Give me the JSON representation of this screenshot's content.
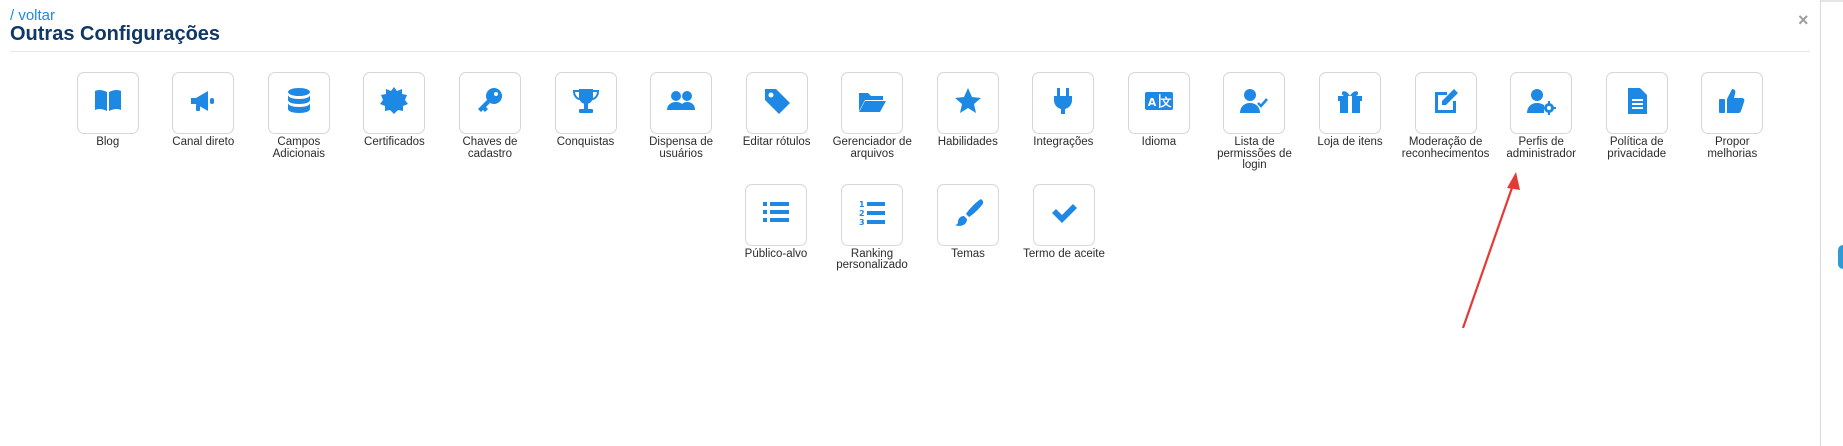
{
  "header": {
    "back_label": "/ voltar",
    "title": "Outras Configurações",
    "close_label": "×"
  },
  "colors": {
    "accent": "#1e88e5",
    "title": "#0f3866",
    "annotation_arrow": "#e53935"
  },
  "items_row1": [
    {
      "label": "Blog",
      "icon": "book-icon"
    },
    {
      "label": "Canal direto",
      "icon": "megaphone-icon"
    },
    {
      "label": "Campos\nAdicionais",
      "icon": "database-icon"
    },
    {
      "label": "Certificados",
      "icon": "certificate-icon"
    },
    {
      "label": "Chaves de\ncadastro",
      "icon": "key-icon"
    },
    {
      "label": "Conquistas",
      "icon": "trophy-icon"
    },
    {
      "label": "Dispensa de\nusuários",
      "icon": "users-icon"
    },
    {
      "label": "Editar rótulos",
      "icon": "tag-icon"
    },
    {
      "label": "Gerenciador de\narquivos",
      "icon": "folder-open-icon"
    },
    {
      "label": "Habilidades",
      "icon": "star-icon"
    },
    {
      "label": "Integrações",
      "icon": "plug-icon"
    },
    {
      "label": "Idioma",
      "icon": "language-icon"
    },
    {
      "label": "Lista de\npermissões de\nlogin",
      "icon": "user-check-icon"
    },
    {
      "label": "Loja de itens",
      "icon": "gift-icon"
    },
    {
      "label": "Moderação de\nreconhecimentos",
      "icon": "edit-icon"
    },
    {
      "label": "Perfis de\nadministrador",
      "icon": "user-gear-icon"
    },
    {
      "label": "Política de\nprivacidade",
      "icon": "file-text-icon"
    },
    {
      "label": "Propor\nmelhorias",
      "icon": "thumbs-up-icon"
    }
  ],
  "items_row2": [
    {
      "label": "Público-alvo",
      "icon": "list-icon"
    },
    {
      "label": "Ranking\npersonalizado",
      "icon": "list-ol-icon"
    },
    {
      "label": "Temas",
      "icon": "brush-icon"
    },
    {
      "label": "Termo de aceite",
      "icon": "check-icon"
    }
  ]
}
